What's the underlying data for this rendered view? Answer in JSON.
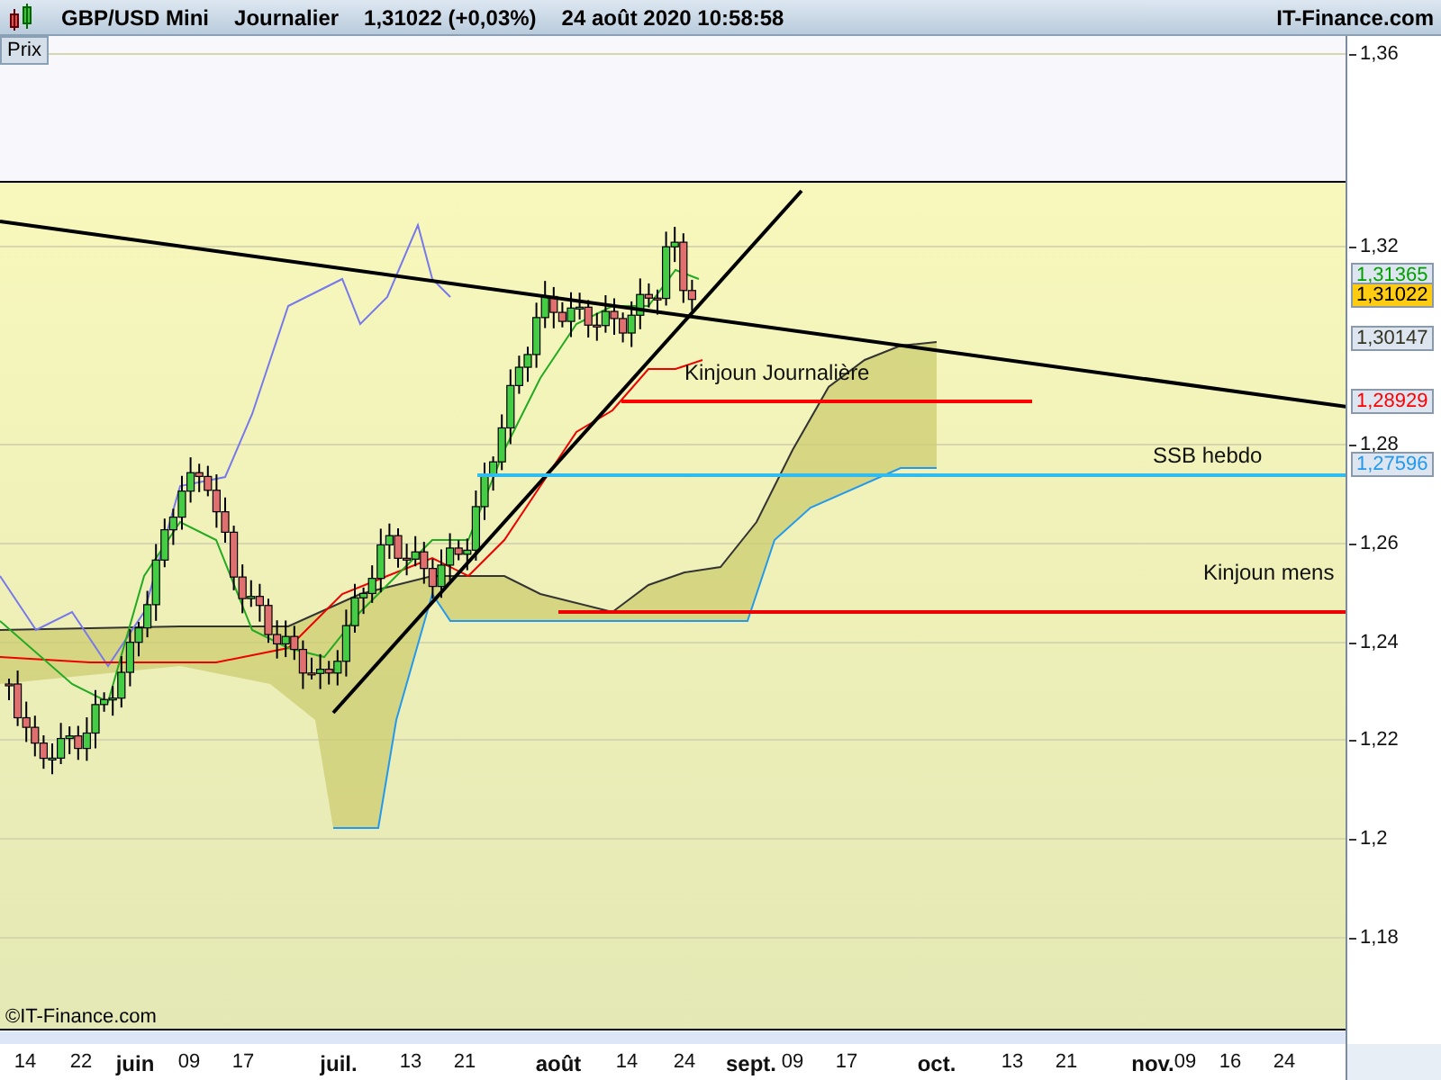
{
  "header": {
    "symbol": "GBP/USD Mini",
    "period": "Journalier",
    "quote": "1,31022 (+0,03%)",
    "datetime": "24 août 2020 10:58:58",
    "brand": "IT-Finance.com"
  },
  "panel": {
    "label": "Prix",
    "watermark": "©IT-Finance.com"
  },
  "levels": [
    {
      "label": "Kinjoun Journalière",
      "color": "#ff0000"
    },
    {
      "label": "SSB hebdo",
      "color": "#33bbee"
    },
    {
      "label": "Kinjoun mens",
      "color": "#ee0000"
    }
  ],
  "y_axis": [
    "1,36",
    "1,32",
    "1,28",
    "1,26",
    "1,24",
    "1,22",
    "1,2",
    "1,18"
  ],
  "price_tags": [
    {
      "label": "1,31365",
      "color": "#00a000",
      "current": false
    },
    {
      "label": "1,31022",
      "color": "#ffcc11",
      "current": true
    },
    {
      "label": "1,30147",
      "color": "#333322",
      "current": false
    },
    {
      "label": "1,28929",
      "color": "#ff0000",
      "current": false
    },
    {
      "label": "1,27596",
      "color": "#2299ee",
      "current": false
    }
  ],
  "x_axis": [
    {
      "label": "14",
      "kind": "day"
    },
    {
      "label": "22",
      "kind": "day"
    },
    {
      "label": "juin",
      "kind": "month"
    },
    {
      "label": "09",
      "kind": "day"
    },
    {
      "label": "17",
      "kind": "day"
    },
    {
      "label": "juil.",
      "kind": "month"
    },
    {
      "label": "13",
      "kind": "day"
    },
    {
      "label": "21",
      "kind": "day"
    },
    {
      "label": "août",
      "kind": "month"
    },
    {
      "label": "14",
      "kind": "day"
    },
    {
      "label": "24",
      "kind": "day"
    },
    {
      "label": "sept.",
      "kind": "month"
    },
    {
      "label": "09",
      "kind": "day"
    },
    {
      "label": "17",
      "kind": "day"
    },
    {
      "label": "oct.",
      "kind": "month"
    },
    {
      "label": "13",
      "kind": "day"
    },
    {
      "label": "21",
      "kind": "day"
    },
    {
      "label": "nov.",
      "kind": "month"
    },
    {
      "label": "09",
      "kind": "day"
    },
    {
      "label": "16",
      "kind": "day"
    },
    {
      "label": "24",
      "kind": "day"
    }
  ]
}
